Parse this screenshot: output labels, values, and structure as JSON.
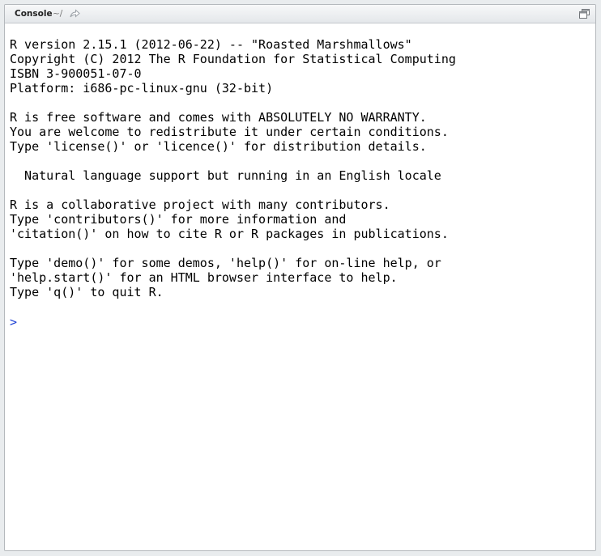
{
  "console": {
    "title": "Console",
    "working_dir": "~/",
    "output": "R version 2.15.1 (2012-06-22) -- \"Roasted Marshmallows\"\nCopyright (C) 2012 The R Foundation for Statistical Computing\nISBN 3-900051-07-0\nPlatform: i686-pc-linux-gnu (32-bit)\n\nR is free software and comes with ABSOLUTELY NO WARRANTY.\nYou are welcome to redistribute it under certain conditions.\nType 'license()' or 'licence()' for distribution details.\n\n  Natural language support but running in an English locale\n\nR is a collaborative project with many contributors.\nType 'contributors()' for more information and\n'citation()' on how to cite R or R packages in publications.\n\nType 'demo()' for some demos, 'help()' for on-line help, or\n'help.start()' for an HTML browser interface to help.\nType 'q()' to quit R.",
    "prompt": ">"
  },
  "icons": {
    "goto_dir": "arrow-right-icon",
    "maximize": "maximize-icon"
  },
  "colors": {
    "prompt": "#1c3fd4",
    "text": "#000000"
  }
}
